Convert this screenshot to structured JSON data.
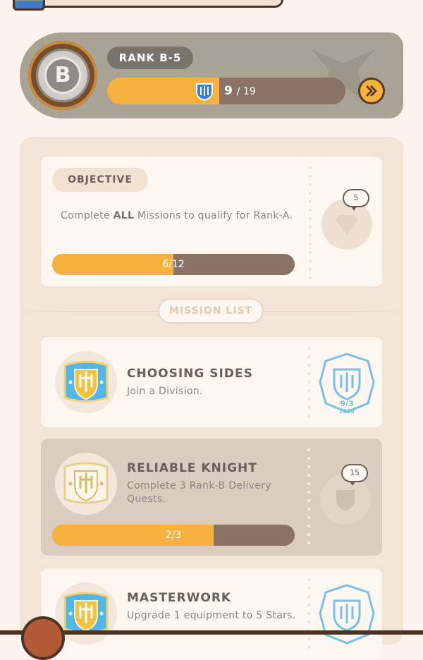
{
  "rank": {
    "badge_letter": "B",
    "label": "RANK B-5",
    "progress_current": "9",
    "progress_total": "/ 19",
    "progress_fraction": 0.47
  },
  "objective": {
    "tag": "OBJECTIVE",
    "desc_prefix": "Complete ",
    "desc_bold": "ALL",
    "desc_suffix": " Missions to qualify for Rank-A.",
    "progress_text": "6/12",
    "progress_fraction": 0.5,
    "reward_count": "5",
    "reward_icon": "gem-icon"
  },
  "mission_list_label": "MISSION LIST",
  "missions": [
    {
      "title": "CHOOSING SIDES",
      "desc": "Join a Division.",
      "icon": "division-shield-icon",
      "stamp_date": "9/3",
      "stamp_year": "2024"
    },
    {
      "title": "RELIABLE KNIGHT",
      "desc": "Complete 3 Rank-B Delivery Quests.",
      "icon": "knight-shield-icon",
      "progress_text": "2/3",
      "progress_fraction": 0.6667,
      "reward_count": "15",
      "reward_icon": "shield-icon"
    },
    {
      "title": "MASTERWORK",
      "desc": "Upgrade 1 equipment to 5 Stars.",
      "icon": "division-shield-icon"
    }
  ],
  "colors": {
    "progress_fill": "#f6b13f",
    "progress_track": "#8a7366",
    "stamp_blue": "#7bbfe6"
  }
}
